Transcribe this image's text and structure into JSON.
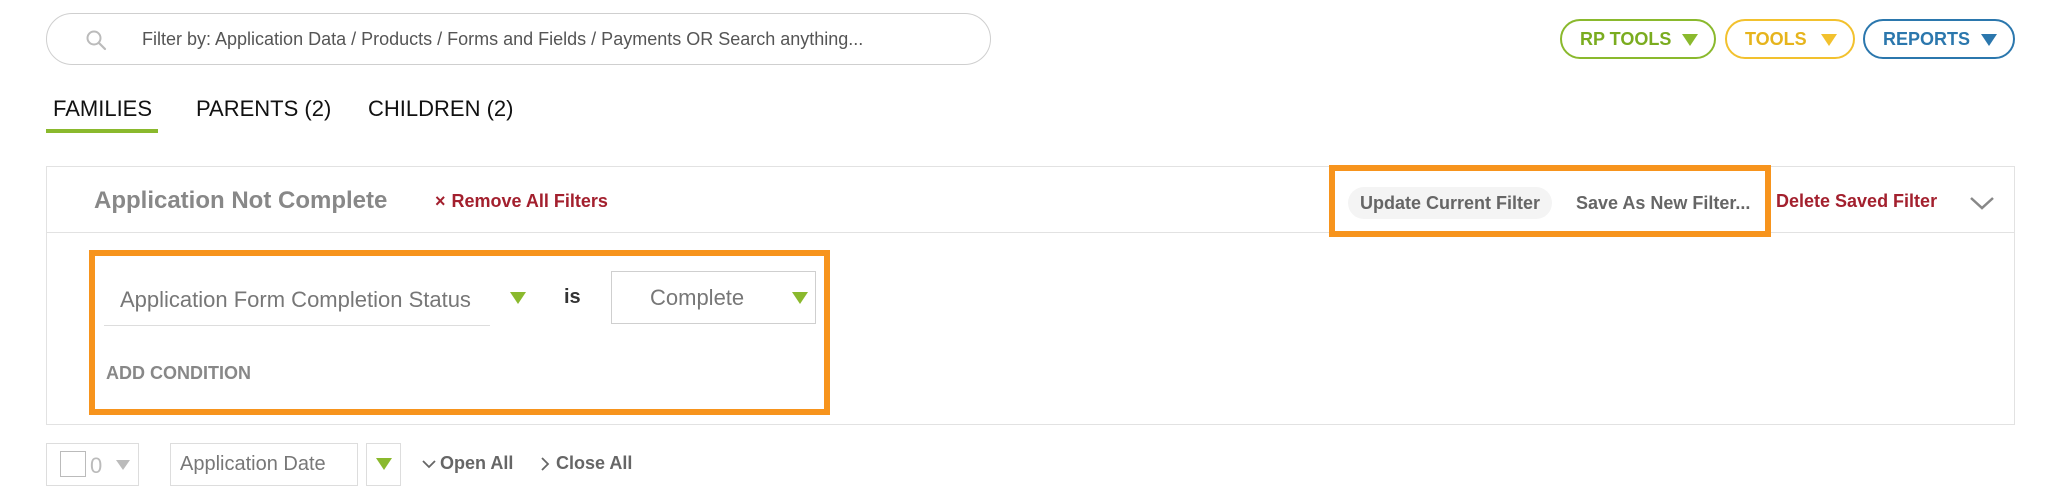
{
  "search": {
    "placeholder": "Filter by: Application Data / Products / Forms and Fields / Payments OR Search anything...",
    "icon": "search-icon"
  },
  "tools": {
    "rp_tools": "RP TOOLS",
    "tools": "TOOLS",
    "reports": "REPORTS"
  },
  "tabs": [
    {
      "label": "FAMILIES",
      "active": true
    },
    {
      "label": "PARENTS (2)",
      "active": false
    },
    {
      "label": "CHILDREN (2)",
      "active": false
    }
  ],
  "filter": {
    "title": "Application Not Complete",
    "remove_all_icon": "×",
    "remove_all": "Remove All Filters",
    "update_current": "Update Current Filter",
    "save_as_new": "Save As New Filter...",
    "delete_saved": "Delete Saved Filter",
    "condition": {
      "field": "Application Form Completion Status",
      "operator": "is",
      "value": "Complete"
    },
    "add_condition": "ADD CONDITION"
  },
  "toolbar": {
    "selected_count": "0",
    "sort_field": "Application Date",
    "open_all": "Open All",
    "close_all": "Close All"
  },
  "colors": {
    "green": "#8ab92d",
    "yellow": "#f2c12e",
    "blue": "#2b77ad",
    "red": "#a3202e",
    "highlight": "#f7941d"
  }
}
